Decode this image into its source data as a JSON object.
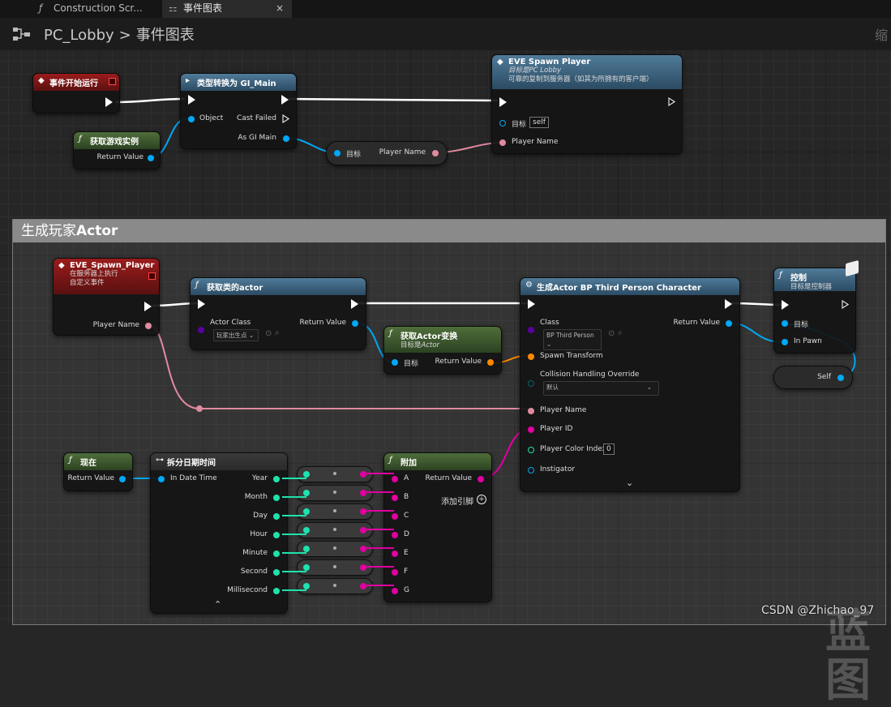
{
  "tabs": [
    {
      "label": "Construction Scr..."
    },
    {
      "label": "事件图表",
      "close": "×"
    }
  ],
  "breadcrumb": {
    "root": "PC_Lobby",
    "sep": ">",
    "current": "事件图表"
  },
  "colors": {
    "exec": "#ffffff",
    "object": "#00a8f4",
    "string": "#f080a0",
    "int": "#1ee2ad",
    "byte": "#006a5f",
    "struct": "#ff8800",
    "class": "#5a00a0",
    "pink": "#f000a0"
  },
  "top": {
    "begin_play": {
      "title": "事件开始运行"
    },
    "get_game_instance": {
      "title": "获取游戏实例",
      "out": "Return Value"
    },
    "cast": {
      "title": "类型转换为 GI_Main",
      "in_object": "Object",
      "cast_failed": "Cast Failed",
      "as_out": "As GI Main"
    },
    "get_player_name": {
      "in": "目标",
      "out": "Player Name"
    },
    "spawn_player": {
      "title": "EVE Spawn Player",
      "sub1": "目标是PC Lobby",
      "sub2": "可靠的复制到服务器（如其为所拥有的客户端）",
      "target_label": "目标",
      "target_value": "self",
      "player_name": "Player Name"
    }
  },
  "comment": {
    "title_zh": "生成玩家",
    "title_en": "Actor"
  },
  "bottom": {
    "custom_event": {
      "title": "EVE_Spawn_Player",
      "sub1": "在服务器上执行",
      "sub2": "自定义事件",
      "out": "Player Name"
    },
    "get_actor_of_class": {
      "title": "获取类的actor",
      "in": "Actor Class",
      "combo": "玩家出生点",
      "out": "Return Value"
    },
    "get_transform": {
      "title_zh": "获取",
      "title_en": "Actor",
      "title_zh2": "变换",
      "sub_zh": "目标是",
      "sub_en": "Actor",
      "in": "目标",
      "out": "Return Value"
    },
    "spawn_actor": {
      "title": "生成Actor BP Third Person Character",
      "class_label": "Class",
      "class_combo": "BP Third Person",
      "out": "Return Value",
      "spawn_transform": "Spawn Transform",
      "collision": "Collision Handling Override",
      "collision_value": "默认",
      "player_name": "Player Name",
      "player_id": "Player ID",
      "color_index": "Player Color Index",
      "color_index_value": "0",
      "instigator": "Instigator",
      "expand": "⌄"
    },
    "possess": {
      "title": "控制",
      "sub": "目标是控制器",
      "target": "目标",
      "in_pawn": "In Pawn"
    },
    "self": {
      "label": "Self"
    },
    "now": {
      "title": "现在",
      "out": "Return Value"
    },
    "break_datetime": {
      "title": "拆分日期时间",
      "in": "In Date Time",
      "outs": [
        "Year",
        "Month",
        "Day",
        "Hour",
        "Minute",
        "Second",
        "Millisecond"
      ],
      "expand": "⌃"
    },
    "append": {
      "title": "附加",
      "out": "Return Value",
      "ins": [
        "A",
        "B",
        "C",
        "D",
        "E",
        "F",
        "G"
      ],
      "add_pin": "添加引脚"
    }
  },
  "watermark": "CSDN @Zhichao_97",
  "bg_text": "蓝图"
}
